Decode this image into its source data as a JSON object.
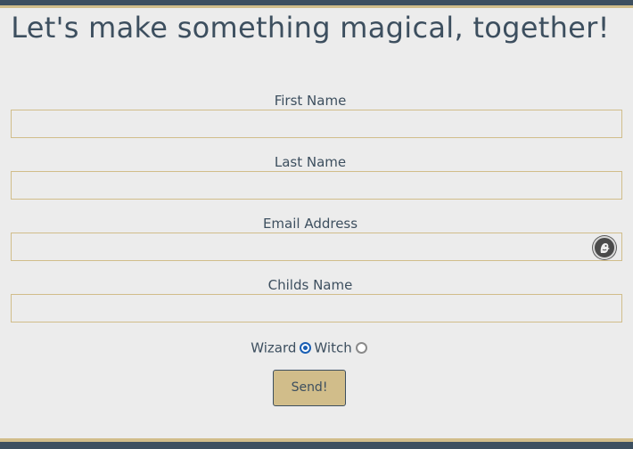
{
  "form": {
    "title": "Let's make something magical, together!",
    "fields": [
      {
        "label": "First Name",
        "value": ""
      },
      {
        "label": "Last Name",
        "value": ""
      },
      {
        "label": "Email Address",
        "value": ""
      },
      {
        "label": "Childs Name",
        "value": ""
      }
    ],
    "options": [
      {
        "label": "Wizard",
        "checked": true
      },
      {
        "label": "Witch",
        "checked": false
      }
    ],
    "submit_label": "Send!"
  },
  "colors": {
    "primary": "#3d4f5f",
    "accent": "#d1bd8a",
    "background": "#ececec",
    "radio_selected": "#1a5fb4"
  },
  "icons": {
    "email_field_extension": "duck-icon"
  }
}
